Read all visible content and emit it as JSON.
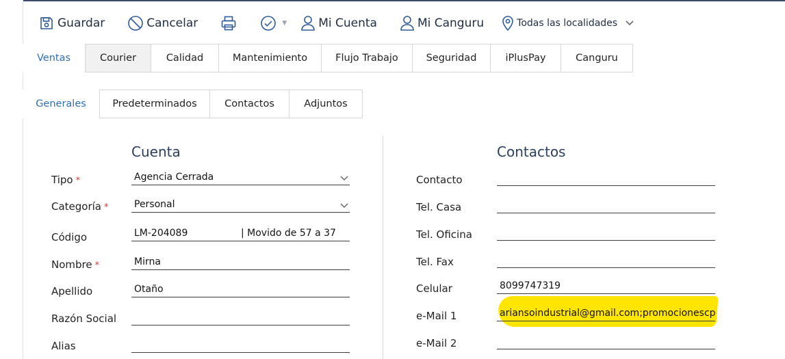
{
  "toolbar": {
    "save_label": "Guardar",
    "cancel_label": "Cancelar",
    "account_label": "Mi Cuenta",
    "canguru_label": "Mi Canguru",
    "location_label": "Todas las localidades"
  },
  "tabs_main": [
    {
      "label": "Ventas",
      "active": true
    },
    {
      "label": "Courier"
    },
    {
      "label": "Calidad"
    },
    {
      "label": "Mantenimiento"
    },
    {
      "label": "Flujo Trabajo"
    },
    {
      "label": "Seguridad"
    },
    {
      "label": "iPlusPay"
    },
    {
      "label": "Canguru"
    }
  ],
  "tabs_sub": [
    {
      "label": "Generales",
      "active": true
    },
    {
      "label": "Predeterminados"
    },
    {
      "label": "Contactos"
    },
    {
      "label": "Adjuntos"
    }
  ],
  "cuenta": {
    "title": "Cuenta",
    "tipo": {
      "label": "Tipo",
      "required": "*",
      "value": "Agencia Cerrada"
    },
    "categoria": {
      "label": "Categoría",
      "required": "*",
      "value": "Personal"
    },
    "codigo": {
      "label": "Código",
      "value": "LM-204089",
      "note": "| Movido de 57 a 37"
    },
    "nombre": {
      "label": "Nombre",
      "required": "*",
      "value": "Mirna"
    },
    "apellido": {
      "label": "Apellido",
      "value": "Otaño"
    },
    "razon_social": {
      "label": "Razón Social",
      "value": ""
    },
    "alias": {
      "label": "Alias",
      "value": ""
    }
  },
  "contactos": {
    "title": "Contactos",
    "contacto": {
      "label": "Contacto",
      "value": ""
    },
    "tel_casa": {
      "label": "Tel. Casa",
      "value": ""
    },
    "tel_oficina": {
      "label": "Tel. Oficina",
      "value": ""
    },
    "tel_fax": {
      "label": "Tel. Fax",
      "value": ""
    },
    "celular": {
      "label": "Celular",
      "value": "8099747319"
    },
    "email1": {
      "label": "e-Mail 1",
      "value": "ariansoindustrial@gmail.com;promocionescpsit"
    },
    "email2": {
      "label": "e-Mail 2",
      "value": ""
    }
  },
  "colors": {
    "accent": "#2f6fb5",
    "required": "#d9342b",
    "highlight": "#ffe500",
    "top_bar": "#3a4a6b"
  },
  "icons": [
    "save-icon",
    "cancel-icon",
    "print-icon",
    "check-circle-icon",
    "caret-down-icon",
    "user-icon",
    "map-pin-icon",
    "chevron-down-icon"
  ]
}
